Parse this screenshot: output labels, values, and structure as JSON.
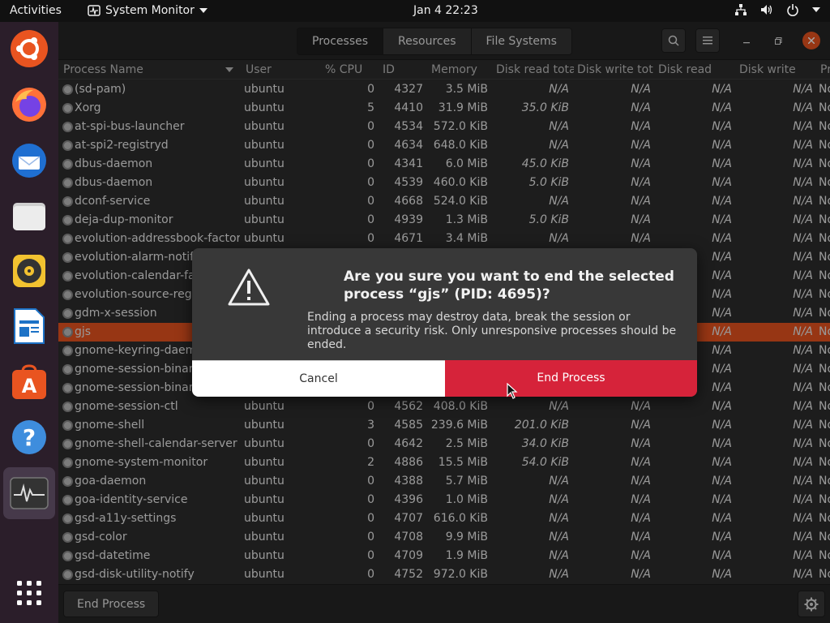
{
  "topbar": {
    "activities": "Activities",
    "app_name": "System Monitor",
    "clock": "Jan 4  22:23",
    "tray_icons": [
      "network-icon",
      "volume-icon",
      "power-icon",
      "chevron-down-icon"
    ]
  },
  "dock": {
    "apps": [
      "ubuntu-logo-icon",
      "firefox-icon",
      "thunderbird-icon",
      "files-icon",
      "rhythmbox-icon",
      "libreoffice-writer-icon",
      "ubuntu-software-icon",
      "help-icon",
      "system-monitor-icon",
      "show-apps-icon"
    ]
  },
  "header": {
    "tabs": [
      {
        "label": "Processes"
      },
      {
        "label": "Resources"
      },
      {
        "label": "File Systems"
      }
    ]
  },
  "table": {
    "columns": {
      "name": "Process Name",
      "user": "User",
      "cpu": "% CPU",
      "id": "ID",
      "memory": "Memory",
      "disk_read_total": "Disk read tota",
      "disk_write_total": "Disk write tot",
      "disk_read": "Disk read",
      "disk_write": "Disk write",
      "priority": "Pr"
    },
    "rows": [
      {
        "name": "(sd-pam)",
        "user": "ubuntu",
        "cpu": "0",
        "id": "4327",
        "mem": "3.5 MiB",
        "drt": "N/A",
        "dwt": "N/A",
        "dr": "N/A",
        "dw": "N/A",
        "pr": "No"
      },
      {
        "name": "Xorg",
        "user": "ubuntu",
        "cpu": "5",
        "id": "4410",
        "mem": "31.9 MiB",
        "drt": "35.0 KiB",
        "dwt": "N/A",
        "dr": "N/A",
        "dw": "N/A",
        "pr": "No"
      },
      {
        "name": "at-spi-bus-launcher",
        "user": "ubuntu",
        "cpu": "0",
        "id": "4534",
        "mem": "572.0 KiB",
        "drt": "N/A",
        "dwt": "N/A",
        "dr": "N/A",
        "dw": "N/A",
        "pr": "No"
      },
      {
        "name": "at-spi2-registryd",
        "user": "ubuntu",
        "cpu": "0",
        "id": "4634",
        "mem": "648.0 KiB",
        "drt": "N/A",
        "dwt": "N/A",
        "dr": "N/A",
        "dw": "N/A",
        "pr": "No"
      },
      {
        "name": "dbus-daemon",
        "user": "ubuntu",
        "cpu": "0",
        "id": "4341",
        "mem": "6.0 MiB",
        "drt": "45.0 KiB",
        "dwt": "N/A",
        "dr": "N/A",
        "dw": "N/A",
        "pr": "No"
      },
      {
        "name": "dbus-daemon",
        "user": "ubuntu",
        "cpu": "0",
        "id": "4539",
        "mem": "460.0 KiB",
        "drt": "5.0 KiB",
        "dwt": "N/A",
        "dr": "N/A",
        "dw": "N/A",
        "pr": "No"
      },
      {
        "name": "dconf-service",
        "user": "ubuntu",
        "cpu": "0",
        "id": "4668",
        "mem": "524.0 KiB",
        "drt": "N/A",
        "dwt": "N/A",
        "dr": "N/A",
        "dw": "N/A",
        "pr": "No"
      },
      {
        "name": "deja-dup-monitor",
        "user": "ubuntu",
        "cpu": "0",
        "id": "4939",
        "mem": "1.3 MiB",
        "drt": "5.0 KiB",
        "dwt": "N/A",
        "dr": "N/A",
        "dw": "N/A",
        "pr": "No"
      },
      {
        "name": "evolution-addressbook-factory",
        "user": "ubuntu",
        "cpu": "0",
        "id": "4671",
        "mem": "3.4 MiB",
        "drt": "N/A",
        "dwt": "N/A",
        "dr": "N/A",
        "dw": "N/A",
        "pr": "No"
      },
      {
        "name": "evolution-alarm-notify",
        "user": "",
        "cpu": "",
        "id": "",
        "mem": "",
        "drt": "",
        "dwt": "",
        "dr": "N/A",
        "dw": "N/A",
        "pr": "No"
      },
      {
        "name": "evolution-calendar-factory",
        "user": "",
        "cpu": "",
        "id": "",
        "mem": "",
        "drt": "",
        "dwt": "",
        "dr": "N/A",
        "dw": "N/A",
        "pr": "No"
      },
      {
        "name": "evolution-source-registry",
        "user": "",
        "cpu": "",
        "id": "",
        "mem": "",
        "drt": "",
        "dwt": "",
        "dr": "N/A",
        "dw": "N/A",
        "pr": "No"
      },
      {
        "name": "gdm-x-session",
        "user": "",
        "cpu": "",
        "id": "",
        "mem": "",
        "drt": "",
        "dwt": "",
        "dr": "N/A",
        "dw": "N/A",
        "pr": "No"
      },
      {
        "name": "gjs",
        "user": "",
        "cpu": "",
        "id": "",
        "mem": "",
        "drt": "",
        "dwt": "",
        "dr": "N/A",
        "dw": "N/A",
        "pr": "No"
      },
      {
        "name": "gnome-keyring-daemon",
        "user": "",
        "cpu": "",
        "id": "",
        "mem": "",
        "drt": "",
        "dwt": "",
        "dr": "N/A",
        "dw": "N/A",
        "pr": "No"
      },
      {
        "name": "gnome-session-binary",
        "user": "",
        "cpu": "",
        "id": "",
        "mem": "",
        "drt": "",
        "dwt": "",
        "dr": "N/A",
        "dw": "N/A",
        "pr": "No"
      },
      {
        "name": "gnome-session-binary",
        "user": "",
        "cpu": "",
        "id": "",
        "mem": "",
        "drt": "",
        "dwt": "",
        "dr": "N/A",
        "dw": "N/A",
        "pr": "No"
      },
      {
        "name": "gnome-session-ctl",
        "user": "ubuntu",
        "cpu": "0",
        "id": "4562",
        "mem": "408.0 KiB",
        "drt": "N/A",
        "dwt": "N/A",
        "dr": "N/A",
        "dw": "N/A",
        "pr": "No"
      },
      {
        "name": "gnome-shell",
        "user": "ubuntu",
        "cpu": "3",
        "id": "4585",
        "mem": "239.6 MiB",
        "drt": "201.0 KiB",
        "dwt": "N/A",
        "dr": "N/A",
        "dw": "N/A",
        "pr": "No"
      },
      {
        "name": "gnome-shell-calendar-server",
        "user": "ubuntu",
        "cpu": "0",
        "id": "4642",
        "mem": "2.5 MiB",
        "drt": "34.0 KiB",
        "dwt": "N/A",
        "dr": "N/A",
        "dw": "N/A",
        "pr": "No"
      },
      {
        "name": "gnome-system-monitor",
        "user": "ubuntu",
        "cpu": "2",
        "id": "4886",
        "mem": "15.5 MiB",
        "drt": "54.0 KiB",
        "dwt": "N/A",
        "dr": "N/A",
        "dw": "N/A",
        "pr": "No"
      },
      {
        "name": "goa-daemon",
        "user": "ubuntu",
        "cpu": "0",
        "id": "4388",
        "mem": "5.7 MiB",
        "drt": "N/A",
        "dwt": "N/A",
        "dr": "N/A",
        "dw": "N/A",
        "pr": "No"
      },
      {
        "name": "goa-identity-service",
        "user": "ubuntu",
        "cpu": "0",
        "id": "4396",
        "mem": "1.0 MiB",
        "drt": "N/A",
        "dwt": "N/A",
        "dr": "N/A",
        "dw": "N/A",
        "pr": "No"
      },
      {
        "name": "gsd-a11y-settings",
        "user": "ubuntu",
        "cpu": "0",
        "id": "4707",
        "mem": "616.0 KiB",
        "drt": "N/A",
        "dwt": "N/A",
        "dr": "N/A",
        "dw": "N/A",
        "pr": "No"
      },
      {
        "name": "gsd-color",
        "user": "ubuntu",
        "cpu": "0",
        "id": "4708",
        "mem": "9.9 MiB",
        "drt": "N/A",
        "dwt": "N/A",
        "dr": "N/A",
        "dw": "N/A",
        "pr": "No"
      },
      {
        "name": "gsd-datetime",
        "user": "ubuntu",
        "cpu": "0",
        "id": "4709",
        "mem": "1.9 MiB",
        "drt": "N/A",
        "dwt": "N/A",
        "dr": "N/A",
        "dw": "N/A",
        "pr": "No"
      },
      {
        "name": "gsd-disk-utility-notify",
        "user": "ubuntu",
        "cpu": "0",
        "id": "4752",
        "mem": "972.0 KiB",
        "drt": "N/A",
        "dwt": "N/A",
        "dr": "N/A",
        "dw": "N/A",
        "pr": "No"
      }
    ],
    "selected_index": 13
  },
  "footer": {
    "end_process_label": "End Process"
  },
  "dialog": {
    "title": "Are you sure you want to end the selected process “gjs” (PID: 4695)?",
    "body": "Ending a process may destroy data, break the session or introduce a security risk. Only unresponsive processes should be ended.",
    "cancel_label": "Cancel",
    "confirm_label": "End Process",
    "confirm_color": "#d6233a"
  },
  "colors": {
    "selection": "#e95420",
    "panel": "#111111",
    "dock": "#2b1e2a"
  }
}
